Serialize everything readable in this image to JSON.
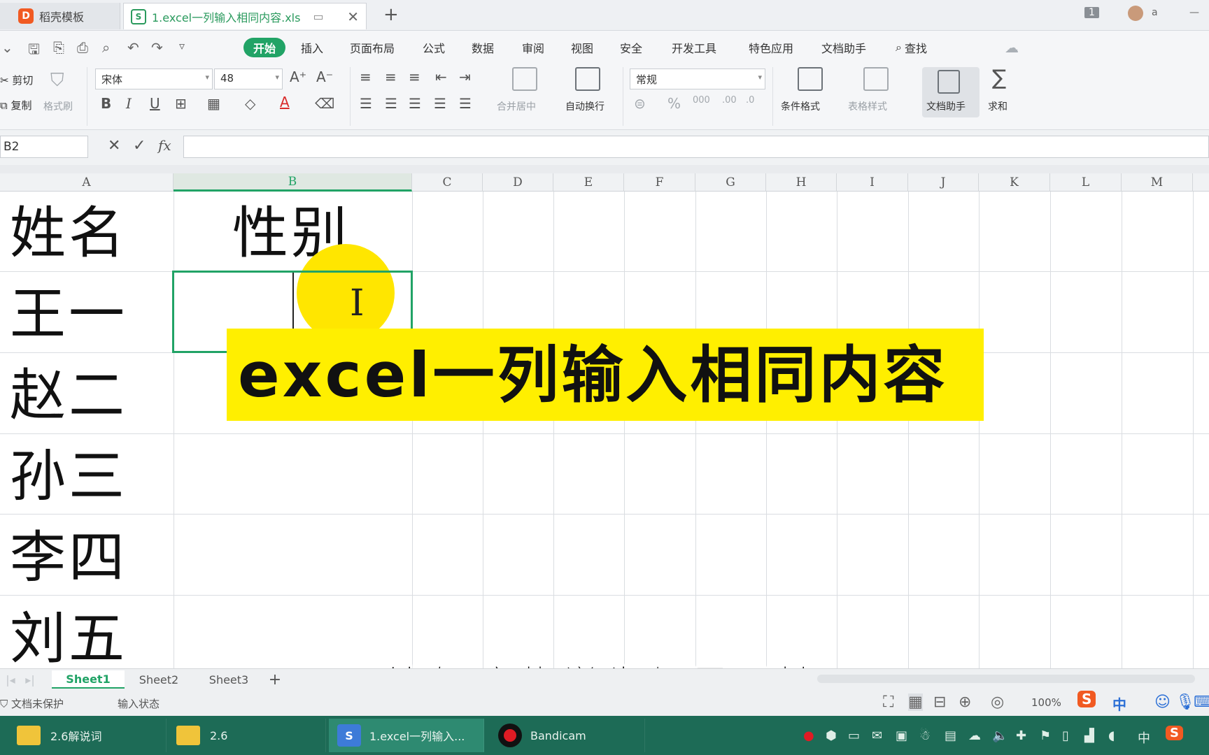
{
  "tabs": {
    "template_tab": "稻壳模板",
    "file_tab": "1.excel一列输入相同内容.xls",
    "new_tab": "+"
  },
  "titlebar": {
    "window_count": "1",
    "user": "a"
  },
  "menu": {
    "items": [
      "开始",
      "插入",
      "页面布局",
      "公式",
      "数据",
      "审阅",
      "视图",
      "安全",
      "开发工具",
      "特色应用",
      "文档助手",
      "查找"
    ]
  },
  "ribbon": {
    "cut": "剪切",
    "copy": "复制",
    "format_painter": "格式刷",
    "font_name": "宋体",
    "font_size": "48",
    "grow": "A⁺",
    "shrink": "A⁻",
    "bold": "B",
    "italic": "I",
    "underline": "U",
    "merge_center": "合并居中",
    "wrap_text": "自动换行",
    "number_format": "常规",
    "percent": "%",
    "conditional_format": "条件格式",
    "table_style": "表格样式",
    "doc_helper": "文档助手",
    "sum": "求和"
  },
  "formula_bar": {
    "name_box": "B2",
    "cancel": "✕",
    "confirm": "✓",
    "fx": "fx",
    "value": ""
  },
  "columns": [
    "A",
    "B",
    "C",
    "D",
    "E",
    "F",
    "G",
    "H",
    "I",
    "J",
    "K",
    "L",
    "M"
  ],
  "sheet": {
    "a1": "姓名",
    "b1": "性别",
    "names": [
      "王一",
      "赵二",
      "孙三",
      "李四",
      "刘五"
    ]
  },
  "overlay": {
    "banner": "excel一列输入相同内容",
    "subtitle": "比如这些学生都是男性",
    "cursor": "I"
  },
  "sheet_tabs": [
    "Sheet1",
    "Sheet2",
    "Sheet3"
  ],
  "sheet_add": "+",
  "status": {
    "protect": "文档未保护",
    "input_state": "输入状态",
    "zoom": "100%",
    "ime": "中"
  },
  "taskbar": {
    "items": [
      "2.6解说词",
      "2.6",
      "1.excel一列输入...",
      "Bandicam"
    ],
    "ime": "中"
  },
  "colors": {
    "accent": "#21a366",
    "banner": "#ffef00",
    "taskbar": "#1d6b56"
  }
}
